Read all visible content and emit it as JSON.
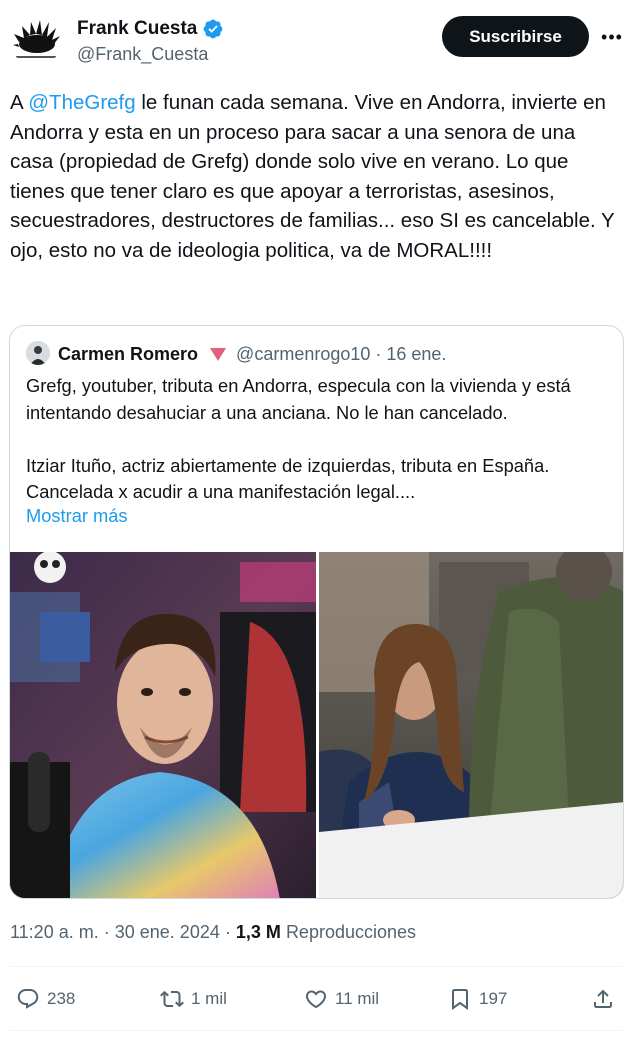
{
  "author": {
    "display_name": "Frank Cuesta",
    "handle": "@Frank_Cuesta",
    "verified": true
  },
  "header": {
    "subscribe_label": "Suscribirse",
    "more_label": "•••"
  },
  "tweet": {
    "text_before_mention": "A ",
    "mention": "@TheGrefg",
    "text_after_mention": " le funan cada semana. Vive en Andorra, invierte en Andorra y esta en un proceso para sacar a una senora de una casa (propiedad de Grefg) donde solo vive en verano. Lo que tienes que tener claro es que apoyar a terroristas, asesinos, secuestradores, destructores de familias... eso SI es cancelable. Y ojo, esto no va de ideologia politica, va de MORAL!!!!"
  },
  "quote": {
    "name": "Carmen Romero",
    "handle": "@carmenrogo10",
    "separator": "·",
    "date": "16 ene.",
    "paragraph_1": "Grefg, youtuber, tributa en Andorra, especula con la vivienda y está intentando desahuciar a una anciana. No le han cancelado.",
    "paragraph_2": "Itziar Ituño, actriz abiertamente de izquierdas, tributa en España. Cancelada x acudir a una manifestación legal....",
    "show_more": "Mostrar más"
  },
  "meta": {
    "time": "11:20 a. m.",
    "separator": "·",
    "date": "30 ene. 2024",
    "views": "1,3 M",
    "views_label": "Reproducciones"
  },
  "actions": {
    "replies": "238",
    "reposts": "1 mil",
    "likes": "11 mil",
    "bookmarks": "197"
  },
  "colors": {
    "accent": "#1d9bf0",
    "text": "#0f1419",
    "secondary": "#536471",
    "border": "#cfd9de"
  }
}
